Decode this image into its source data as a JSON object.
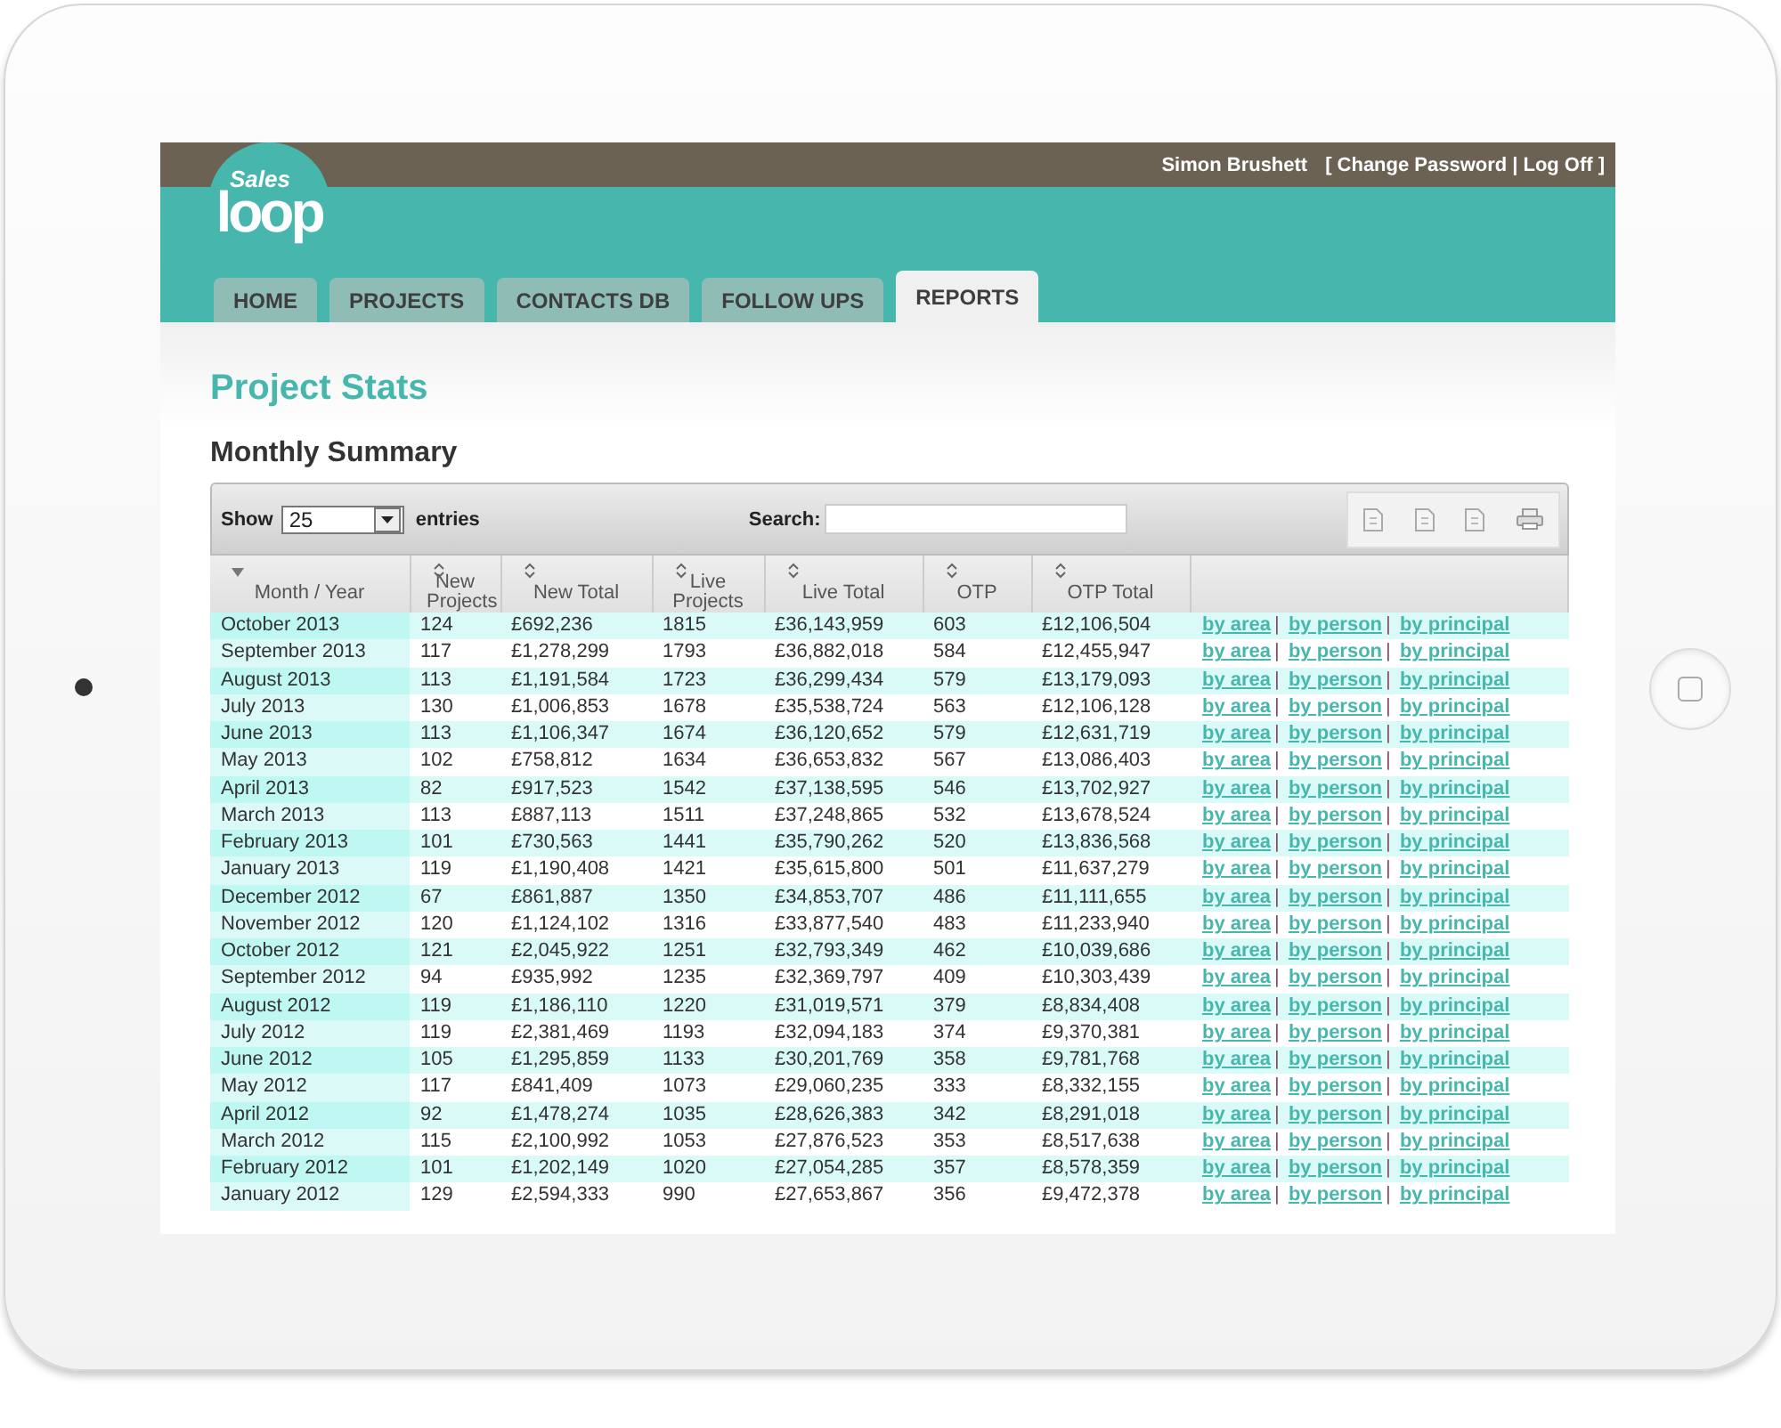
{
  "logo": {
    "top": "Sales",
    "bottom": "loop"
  },
  "user_bar": {
    "user": "Simon Brushett",
    "open": "[",
    "links": [
      "Change Password",
      "Log Off"
    ],
    "separator": "|",
    "close": "]"
  },
  "tabs": [
    {
      "label": "HOME",
      "selected": false
    },
    {
      "label": "PROJECTS",
      "selected": false
    },
    {
      "label": "CONTACTS DB",
      "selected": false
    },
    {
      "label": "FOLLOW UPS",
      "selected": false
    },
    {
      "label": "REPORTS",
      "selected": true
    }
  ],
  "page_title": "Project Stats",
  "section_title": "Monthly Summary",
  "table": {
    "show_label": "Show",
    "page_size": "25",
    "entries_label": "entries",
    "search_label": "Search:",
    "columns": [
      {
        "label": "Month / Year",
        "sorted": true
      },
      {
        "label": "New Projects",
        "sorted": false
      },
      {
        "label": "New Total",
        "sorted": false
      },
      {
        "label": "Live Projects",
        "sorted": false
      },
      {
        "label": "Live Total",
        "sorted": false
      },
      {
        "label": "OTP",
        "sorted": false
      },
      {
        "label": "OTP Total",
        "sorted": false
      }
    ],
    "link_separator": "|",
    "rows": [
      {
        "cells": [
          "October 2013",
          "124",
          "£692,236",
          "1815",
          "£36,143,959",
          "603",
          "£12,106,504"
        ],
        "links": [
          "by area",
          "by person",
          "by principal"
        ]
      },
      {
        "cells": [
          "September 2013",
          "117",
          "£1,278,299",
          "1793",
          "£36,882,018",
          "584",
          "£12,455,947"
        ],
        "links": [
          "by area",
          "by person",
          "by principal"
        ]
      },
      {
        "cells": [
          "August 2013",
          "113",
          "£1,191,584",
          "1723",
          "£36,299,434",
          "579",
          "£13,179,093"
        ],
        "links": [
          "by area",
          "by person",
          "by principal"
        ]
      },
      {
        "cells": [
          "July 2013",
          "130",
          "£1,006,853",
          "1678",
          "£35,538,724",
          "563",
          "£12,106,128"
        ],
        "links": [
          "by area",
          "by person",
          "by principal"
        ]
      },
      {
        "cells": [
          "June 2013",
          "113",
          "£1,106,347",
          "1674",
          "£36,120,652",
          "579",
          "£12,631,719"
        ],
        "links": [
          "by area",
          "by person",
          "by principal"
        ]
      },
      {
        "cells": [
          "May 2013",
          "102",
          "£758,812",
          "1634",
          "£36,653,832",
          "567",
          "£13,086,403"
        ],
        "links": [
          "by area",
          "by person",
          "by principal"
        ]
      },
      {
        "cells": [
          "April 2013",
          "82",
          "£917,523",
          "1542",
          "£37,138,595",
          "546",
          "£13,702,927"
        ],
        "links": [
          "by area",
          "by person",
          "by principal"
        ]
      },
      {
        "cells": [
          "March 2013",
          "113",
          "£887,113",
          "1511",
          "£37,248,865",
          "532",
          "£13,678,524"
        ],
        "links": [
          "by area",
          "by person",
          "by principal"
        ]
      },
      {
        "cells": [
          "February 2013",
          "101",
          "£730,563",
          "1441",
          "£35,790,262",
          "520",
          "£13,836,568"
        ],
        "links": [
          "by area",
          "by person",
          "by principal"
        ]
      },
      {
        "cells": [
          "January 2013",
          "119",
          "£1,190,408",
          "1421",
          "£35,615,800",
          "501",
          "£11,637,279"
        ],
        "links": [
          "by area",
          "by person",
          "by principal"
        ]
      },
      {
        "cells": [
          "December 2012",
          "67",
          "£861,887",
          "1350",
          "£34,853,707",
          "486",
          "£11,111,655"
        ],
        "links": [
          "by area",
          "by person",
          "by principal"
        ]
      },
      {
        "cells": [
          "November 2012",
          "120",
          "£1,124,102",
          "1316",
          "£33,877,540",
          "483",
          "£11,233,940"
        ],
        "links": [
          "by area",
          "by person",
          "by principal"
        ]
      },
      {
        "cells": [
          "October 2012",
          "121",
          "£2,045,922",
          "1251",
          "£32,793,349",
          "462",
          "£10,039,686"
        ],
        "links": [
          "by area",
          "by person",
          "by principal"
        ]
      },
      {
        "cells": [
          "September 2012",
          "94",
          "£935,992",
          "1235",
          "£32,369,797",
          "409",
          "£10,303,439"
        ],
        "links": [
          "by area",
          "by person",
          "by principal"
        ]
      },
      {
        "cells": [
          "August 2012",
          "119",
          "£1,186,110",
          "1220",
          "£31,019,571",
          "379",
          "£8,834,408"
        ],
        "links": [
          "by area",
          "by person",
          "by principal"
        ]
      },
      {
        "cells": [
          "July 2012",
          "119",
          "£2,381,469",
          "1193",
          "£32,094,183",
          "374",
          "£9,370,381"
        ],
        "links": [
          "by area",
          "by person",
          "by principal"
        ]
      },
      {
        "cells": [
          "June 2012",
          "105",
          "£1,295,859",
          "1133",
          "£30,201,769",
          "358",
          "£9,781,768"
        ],
        "links": [
          "by area",
          "by person",
          "by principal"
        ]
      },
      {
        "cells": [
          "May 2012",
          "117",
          "£841,409",
          "1073",
          "£29,060,235",
          "333",
          "£8,332,155"
        ],
        "links": [
          "by area",
          "by person",
          "by principal"
        ]
      },
      {
        "cells": [
          "April 2012",
          "92",
          "£1,478,274",
          "1035",
          "£28,626,383",
          "342",
          "£8,291,018"
        ],
        "links": [
          "by area",
          "by person",
          "by principal"
        ]
      },
      {
        "cells": [
          "March 2012",
          "115",
          "£2,100,992",
          "1053",
          "£27,876,523",
          "353",
          "£8,517,638"
        ],
        "links": [
          "by area",
          "by person",
          "by principal"
        ]
      },
      {
        "cells": [
          "February 2012",
          "101",
          "£1,202,149",
          "1020",
          "£27,054,285",
          "357",
          "£8,578,359"
        ],
        "links": [
          "by area",
          "by person",
          "by principal"
        ]
      },
      {
        "cells": [
          "January 2012",
          "129",
          "£2,594,333",
          "990",
          "£27,653,867",
          "356",
          "£9,472,378"
        ],
        "links": [
          "by area",
          "by person",
          "by principal"
        ]
      }
    ]
  }
}
